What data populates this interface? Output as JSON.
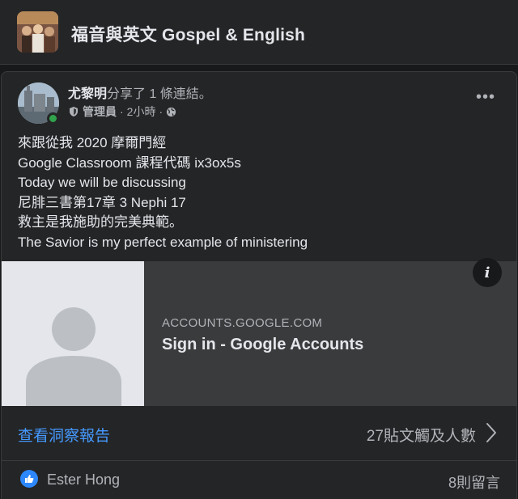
{
  "group": {
    "title": "福音與英文 Gospel & English",
    "thumbnail_icon": "group-photo"
  },
  "post": {
    "author": "尤黎明",
    "action": "分享了 1 條連結。",
    "role": "管理員",
    "time": "2小時",
    "separator": "·",
    "privacy_icon": "globe-icon",
    "more_label": "•••",
    "lines": [
      "來跟從我 2020 摩爾門經",
      "Google Classroom 課程代碼 ix3ox5s",
      "Today we will be discussing",
      "尼腓三書第17章 3 Nephi 17",
      "救主是我施助的完美典範。",
      "The Savior is my perfect example of ministering"
    ]
  },
  "link_preview": {
    "domain": "ACCOUNTS.GOOGLE.COM",
    "title": "Sign in - Google Accounts",
    "info_label": "i",
    "thumbnail_icon": "default-profile-silhouette"
  },
  "insights": {
    "link_label": "查看洞察報告",
    "reach_label": "27貼文觸及人數"
  },
  "reactions": {
    "reactor": "Ester Hong",
    "comments_label": "8則留言",
    "icon": "like-icon"
  },
  "colors": {
    "background": "#18191a",
    "surface": "#242526",
    "link_blue": "#4599ff",
    "like_blue": "#2d88ff",
    "online_green": "#31a24c"
  }
}
